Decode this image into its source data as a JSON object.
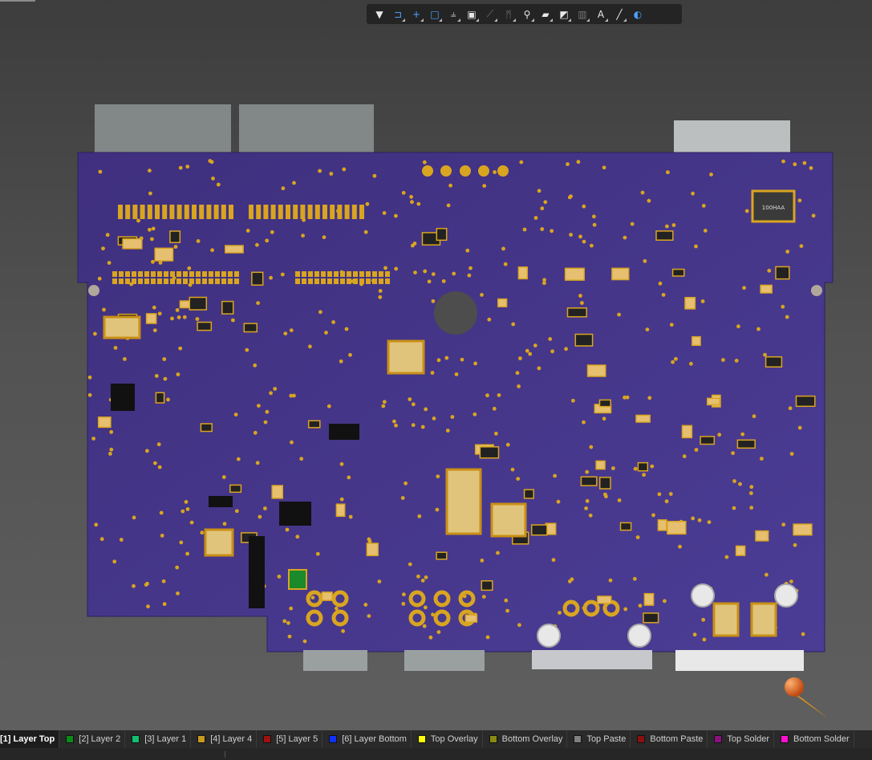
{
  "toolbar": {
    "buttons": [
      {
        "icon": "filter-icon",
        "glyph": "▼",
        "color": "#e8e8e8"
      },
      {
        "icon": "magnet-icon",
        "glyph": "⊐",
        "color": "#4aa3ff"
      },
      {
        "icon": "crosshair-icon",
        "glyph": "+",
        "color": "#4aa3ff"
      },
      {
        "icon": "select-rect-icon",
        "glyph": "□",
        "color": "#4aa3ff"
      },
      {
        "icon": "align-icon",
        "glyph": "⫨",
        "color": "#e8e8e8"
      },
      {
        "icon": "component-icon",
        "glyph": "▣",
        "color": "#e8e8e8"
      },
      {
        "icon": "route-icon",
        "glyph": "⟋",
        "color": "#777777"
      },
      {
        "icon": "diff-pair-icon",
        "glyph": "ᛗ",
        "color": "#777777"
      },
      {
        "icon": "via-icon",
        "glyph": "⚲",
        "color": "#e8e8e8"
      },
      {
        "icon": "fill-icon",
        "glyph": "▰",
        "color": "#e8e8e8"
      },
      {
        "icon": "polygon-icon",
        "glyph": "◩",
        "color": "#e8e8e8"
      },
      {
        "icon": "chart-icon",
        "glyph": "▥",
        "color": "#777777"
      },
      {
        "icon": "text-icon",
        "glyph": "A",
        "color": "#e8e8e8"
      },
      {
        "icon": "line-icon",
        "glyph": "╱",
        "color": "#e8e8e8"
      },
      {
        "icon": "3d-body-icon",
        "glyph": "◐",
        "color": "#4aa3ff"
      }
    ]
  },
  "board": {
    "substrate_color": "#4a3a8e",
    "pad_color": "#d9a520",
    "connector_color": "#9aa0a0"
  },
  "silkscreen": {
    "inductor_marking": "100HAA"
  },
  "layers": [
    {
      "label": "[1] Layer Top",
      "color": "#d01010",
      "active": true
    },
    {
      "label": "[2] Layer 2",
      "color": "#0a8a1a",
      "active": false
    },
    {
      "label": "[3] Layer 1",
      "color": "#10c070",
      "active": false
    },
    {
      "label": "[4] Layer 4",
      "color": "#c89a20",
      "active": false
    },
    {
      "label": "[5] Layer 5",
      "color": "#a01010",
      "active": false
    },
    {
      "label": "[6] Layer Bottom",
      "color": "#1030ff",
      "active": false
    },
    {
      "label": "Top Overlay",
      "color": "#ffff00",
      "active": false
    },
    {
      "label": "Bottom Overlay",
      "color": "#8a8a10",
      "active": false
    },
    {
      "label": "Top Paste",
      "color": "#808080",
      "active": false
    },
    {
      "label": "Bottom Paste",
      "color": "#8a1010",
      "active": false
    },
    {
      "label": "Top Solder",
      "color": "#8a1080",
      "active": false
    },
    {
      "label": "Bottom Solder",
      "color": "#ff10d0",
      "active": false
    }
  ]
}
